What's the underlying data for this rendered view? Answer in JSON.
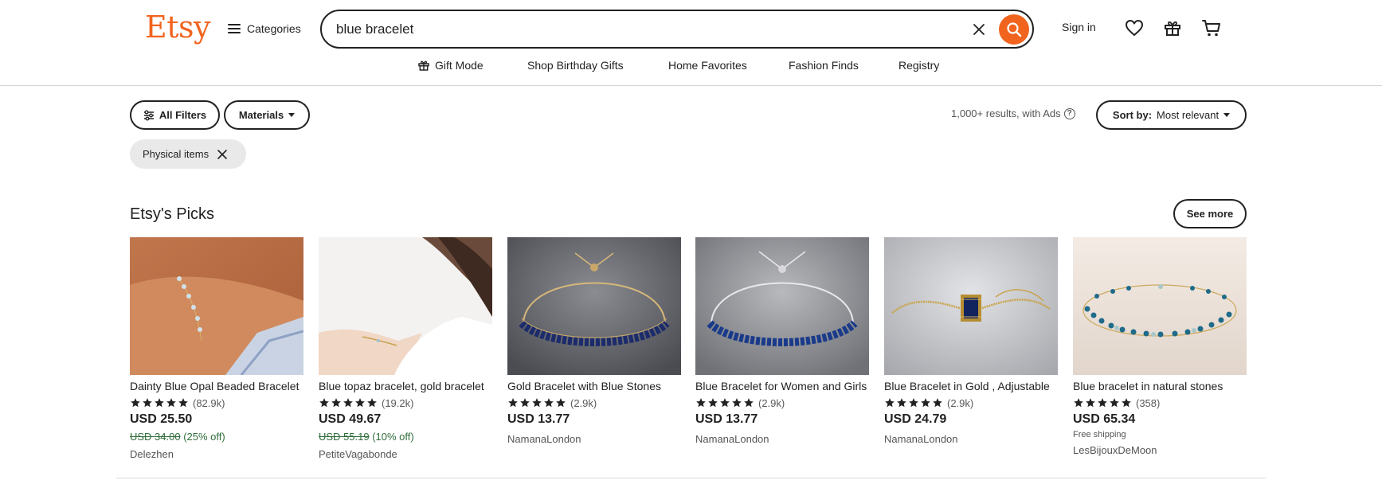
{
  "header": {
    "logo": "Etsy",
    "categories_label": "Categories",
    "search_value": "blue bracelet",
    "signin_label": "Sign in"
  },
  "subnav": {
    "items": [
      "Gift Mode",
      "Shop Birthday Gifts",
      "Home Favorites",
      "Fashion Finds",
      "Registry"
    ]
  },
  "filters": {
    "all_filters_label": "All Filters",
    "materials_label": "Materials",
    "results_text": "1,000+ results, with Ads",
    "sort_prefix": "Sort by:",
    "sort_value": "Most relevant",
    "chip_label": "Physical items"
  },
  "section": {
    "title": "Etsy's Picks",
    "see_more_label": "See more"
  },
  "colors": {
    "brand": "#f1641e",
    "sale_green": "#2f6d3a"
  },
  "products": [
    {
      "title": "Dainty Blue Opal Beaded Bracelet",
      "reviews": "(82.9k)",
      "rating": 5,
      "price": "USD 25.50",
      "original_price": "USD 34.00",
      "discount": "(25% off)",
      "shop": "Delezhen"
    },
    {
      "title": "Blue topaz bracelet, gold bracelet",
      "reviews": "(19.2k)",
      "rating": 5,
      "price": "USD 49.67",
      "original_price": "USD 55.19",
      "discount": "(10% off)",
      "shop": "PetiteVagabonde"
    },
    {
      "title": "Gold Bracelet with Blue Stones",
      "reviews": "(2.9k)",
      "rating": 5,
      "price": "USD 13.77",
      "shop": "NamanaLondon"
    },
    {
      "title": "Blue Bracelet for Women and Girls",
      "reviews": "(2.9k)",
      "rating": 5,
      "price": "USD 13.77",
      "shop": "NamanaLondon"
    },
    {
      "title": "Blue Bracelet in Gold , Adjustable",
      "reviews": "(2.9k)",
      "rating": 5,
      "price": "USD 24.79",
      "shop": "NamanaLondon"
    },
    {
      "title": "Blue bracelet in natural stones",
      "reviews": "(358)",
      "rating": 5,
      "price": "USD 65.34",
      "free_shipping": "Free shipping",
      "shop": "LesBijouxDeMoon"
    }
  ]
}
